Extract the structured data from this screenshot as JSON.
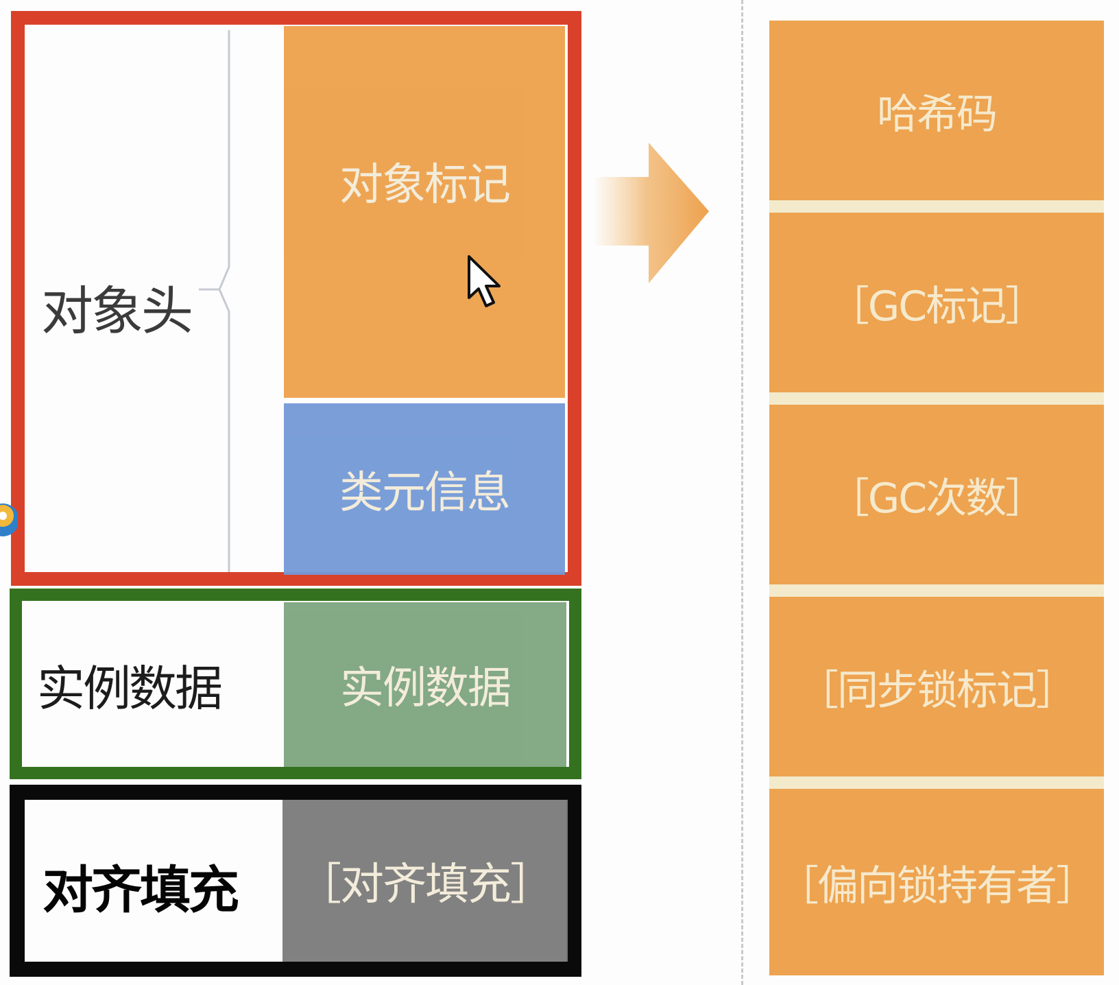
{
  "object_layout": {
    "header_label": "对象头",
    "header_blocks": {
      "mark": "对象标记",
      "klass": "类元信息"
    },
    "instance_label": "实例数据",
    "instance_block": "实例数据",
    "padding_label": "对齐填充",
    "padding_block": "［对齐填充］"
  },
  "mark_word": {
    "fields": [
      "哈希码",
      "［GC标记］",
      "［GC次数］",
      "［同步锁标记］",
      "［偏向锁持有者］"
    ]
  },
  "colors": {
    "header_outline": "#d9412b",
    "instance_outline": "#35721f",
    "padding_outline": "#0a0a0a",
    "mark_block": "#eda14c",
    "klass_block": "#7499d7",
    "instance_block": "#7da57f",
    "padding_block": "#7b7b7b",
    "mark_word_cell": "#eda34f"
  },
  "icons": {
    "cursor": "pointer-cursor-icon",
    "arrow": "right-arrow-icon",
    "badge": "edge-badge-icon"
  }
}
